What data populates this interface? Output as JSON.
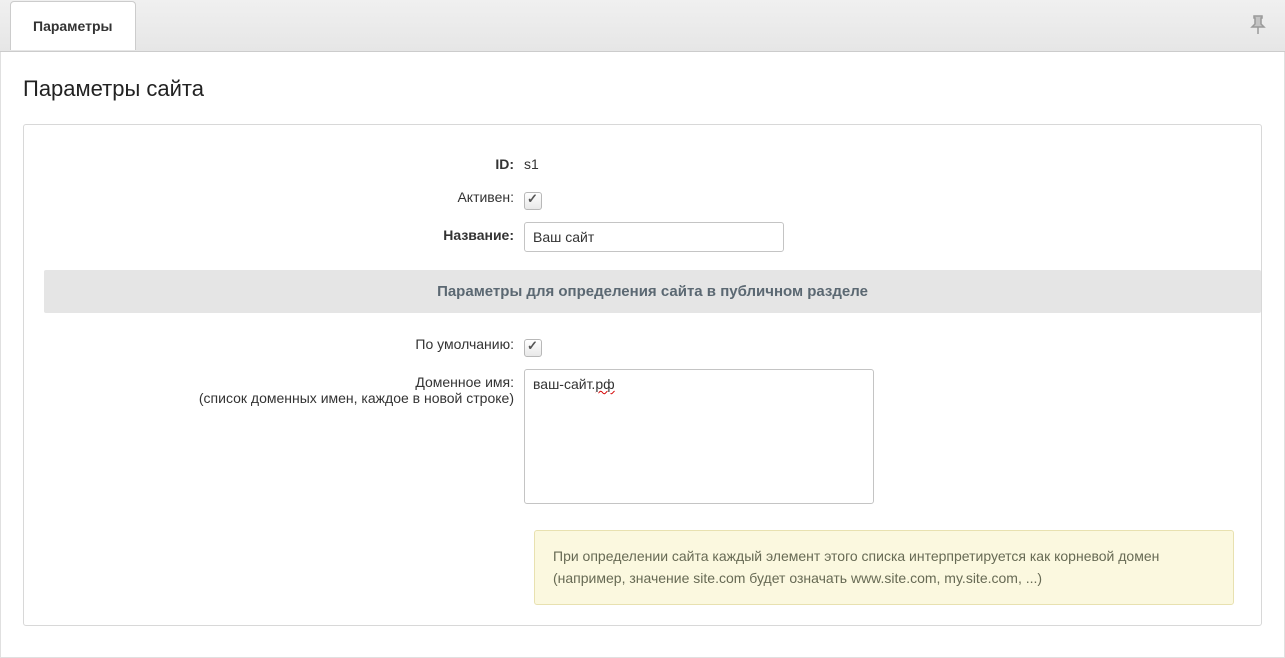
{
  "header": {
    "tab_label": "Параметры"
  },
  "page": {
    "title": "Параметры сайта"
  },
  "form": {
    "id_label": "ID:",
    "id_value": "s1",
    "active_label": "Активен:",
    "active_checked": true,
    "name_label": "Название:",
    "name_value": "Ваш сайт",
    "section_heading": "Параметры для определения сайта в публичном разделе",
    "default_label": "По умолчанию:",
    "default_checked": true,
    "domain_label": "Доменное имя:",
    "domain_sublabel": "(список доменных имен, каждое в новой строке)",
    "domain_value_prefix": "ваш-сайт.",
    "domain_value_suffix": "рф",
    "hint_text": "При определении сайта каждый элемент этого списка интерпретируется как корневой домен (например, значение site.com будет означать www.site.com, my.site.com, ...)"
  }
}
